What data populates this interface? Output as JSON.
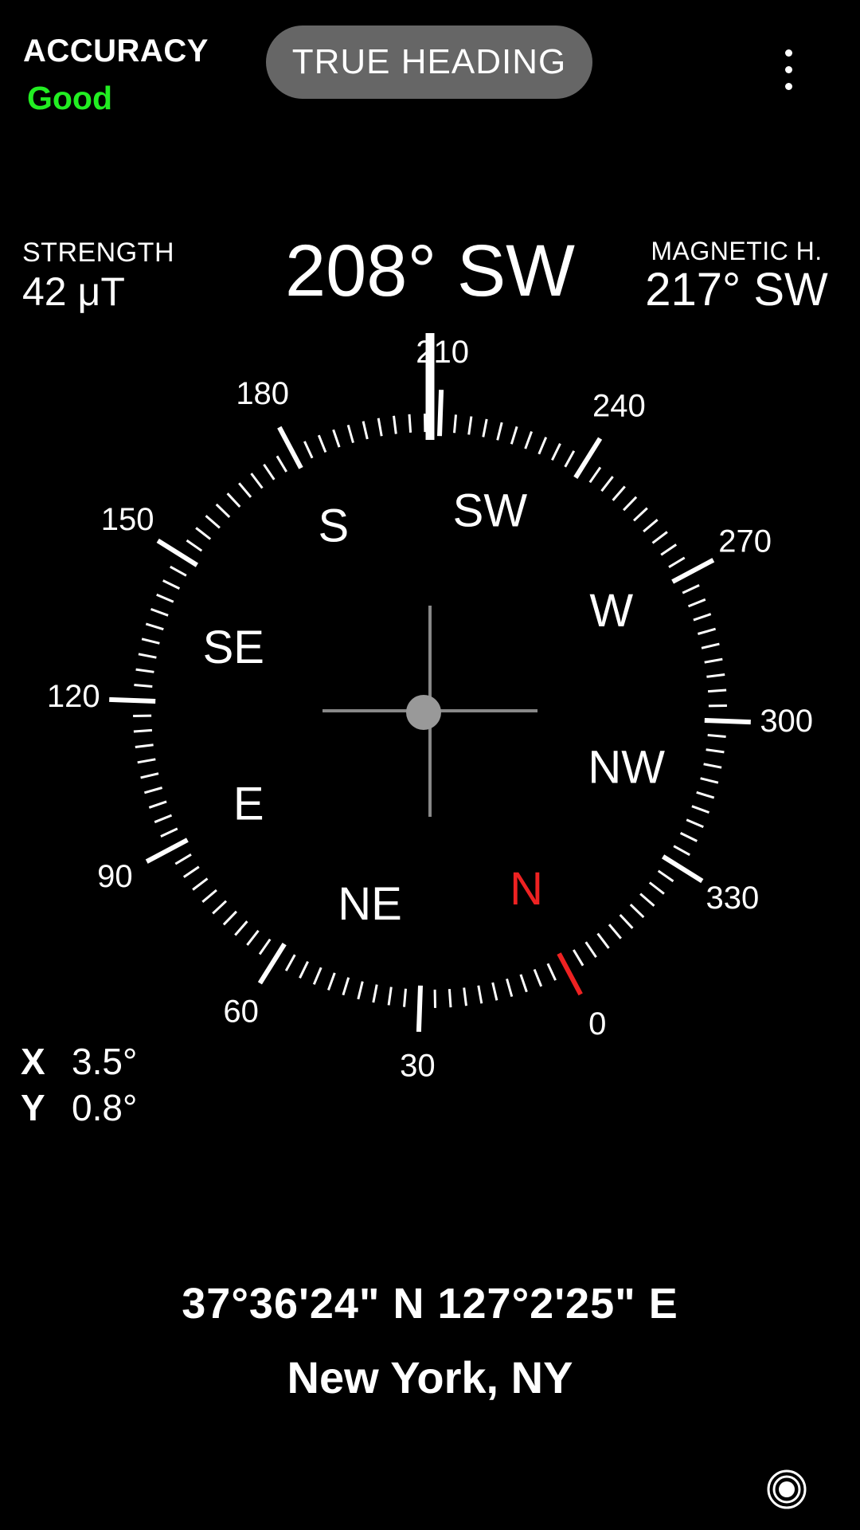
{
  "accuracy": {
    "label": "ACCURACY",
    "value": "Good",
    "color": "#22ee22"
  },
  "mode_button": {
    "label": "TRUE HEADING"
  },
  "menu": {
    "icon": "more-vert-icon"
  },
  "strength": {
    "label": "STRENGTH",
    "value": "42 μT"
  },
  "heading": {
    "value": "208° SW",
    "degrees": 208
  },
  "magnetic": {
    "label": "MAGNETIC H.",
    "value": "217° SW"
  },
  "compass": {
    "degree_labels": [
      "0",
      "30",
      "60",
      "90",
      "120",
      "150",
      "180",
      "210",
      "240",
      "270",
      "300",
      "330"
    ],
    "directions": [
      "N",
      "NE",
      "E",
      "SE",
      "S",
      "SW",
      "W",
      "NW"
    ],
    "north_color": "#ee2222"
  },
  "tilt": {
    "x_label": "X",
    "x_value": "3.5°",
    "y_label": "Y",
    "y_value": "0.8°"
  },
  "coordinates": "37°36'24\" N 127°2'25\" E",
  "location": "New York, NY",
  "bottom_icon": "target-icon"
}
